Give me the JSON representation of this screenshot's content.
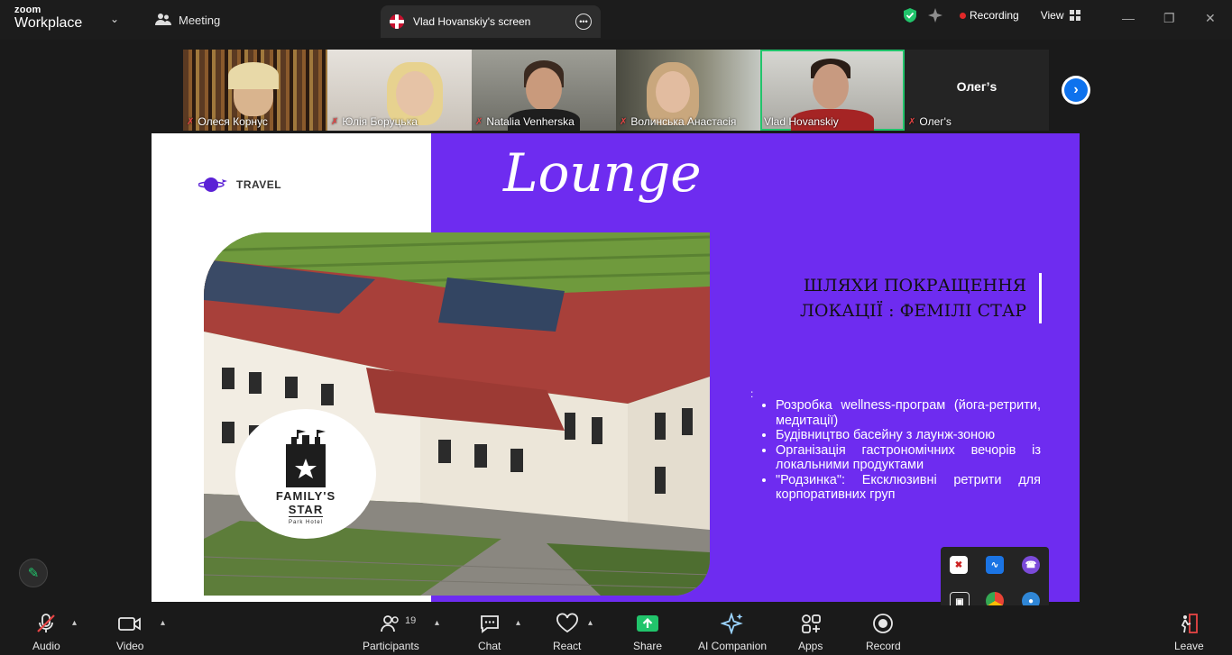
{
  "app": {
    "brand_top": "zoom",
    "brand_bottom": "Workplace"
  },
  "titlebar": {
    "meeting_label": "Meeting",
    "screen_tab_label": "Vlad Hovanskiy's screen",
    "recording_label": "Recording",
    "view_label": "View"
  },
  "participants": [
    {
      "name": "Олеся Корнус",
      "muted": true
    },
    {
      "name": "Юлія Боруцька",
      "muted": true
    },
    {
      "name": "Natalia Venherska",
      "muted": true
    },
    {
      "name": "Волинська Анастасія",
      "muted": true
    },
    {
      "name": "Vlad Hovanskiy",
      "muted": false,
      "active": true
    },
    {
      "name": "Олег's",
      "display": "Олег’s",
      "muted": true
    }
  ],
  "slide": {
    "brand": "TRAVEL",
    "script_title": "Lounge",
    "heading_line1": "ШЛЯХИ ПОКРАЩЕННЯ",
    "heading_line2": "ЛОКАЦІЇ : ФЕМІЛІ СТАР",
    "colon": ":",
    "bullets": [
      "Розробка wellness-програм (йога-ретрити, медитації)",
      "Будівництво басейну з лаунж-зоною",
      "Організація гастрономічних вечорів із локальними продуктами",
      "\"Родзинка\": Ексклюзивні ретрити для корпоративних груп"
    ],
    "logo_line1": "FAMILY'S",
    "logo_line2": "STAR",
    "logo_line3": "Park Hotel"
  },
  "toolbar": {
    "audio": "Audio",
    "video": "Video",
    "participants": "Participants",
    "participants_count": "19",
    "chat": "Chat",
    "react": "React",
    "share": "Share",
    "ai": "AI Companion",
    "apps": "Apps",
    "record": "Record",
    "leave": "Leave"
  },
  "tray_icons": [
    "shield-x-icon",
    "waves-app-icon",
    "viber-icon",
    "camera-app-icon",
    "chrome-icon",
    "browser-app-icon",
    "zoom-app-icon"
  ],
  "colors": {
    "slide_purple": "#6e2cf0",
    "active_tile": "#21c46b",
    "share_green": "#21c46b",
    "zoom_blue": "#0e72ed",
    "recording_red": "#e02828"
  }
}
